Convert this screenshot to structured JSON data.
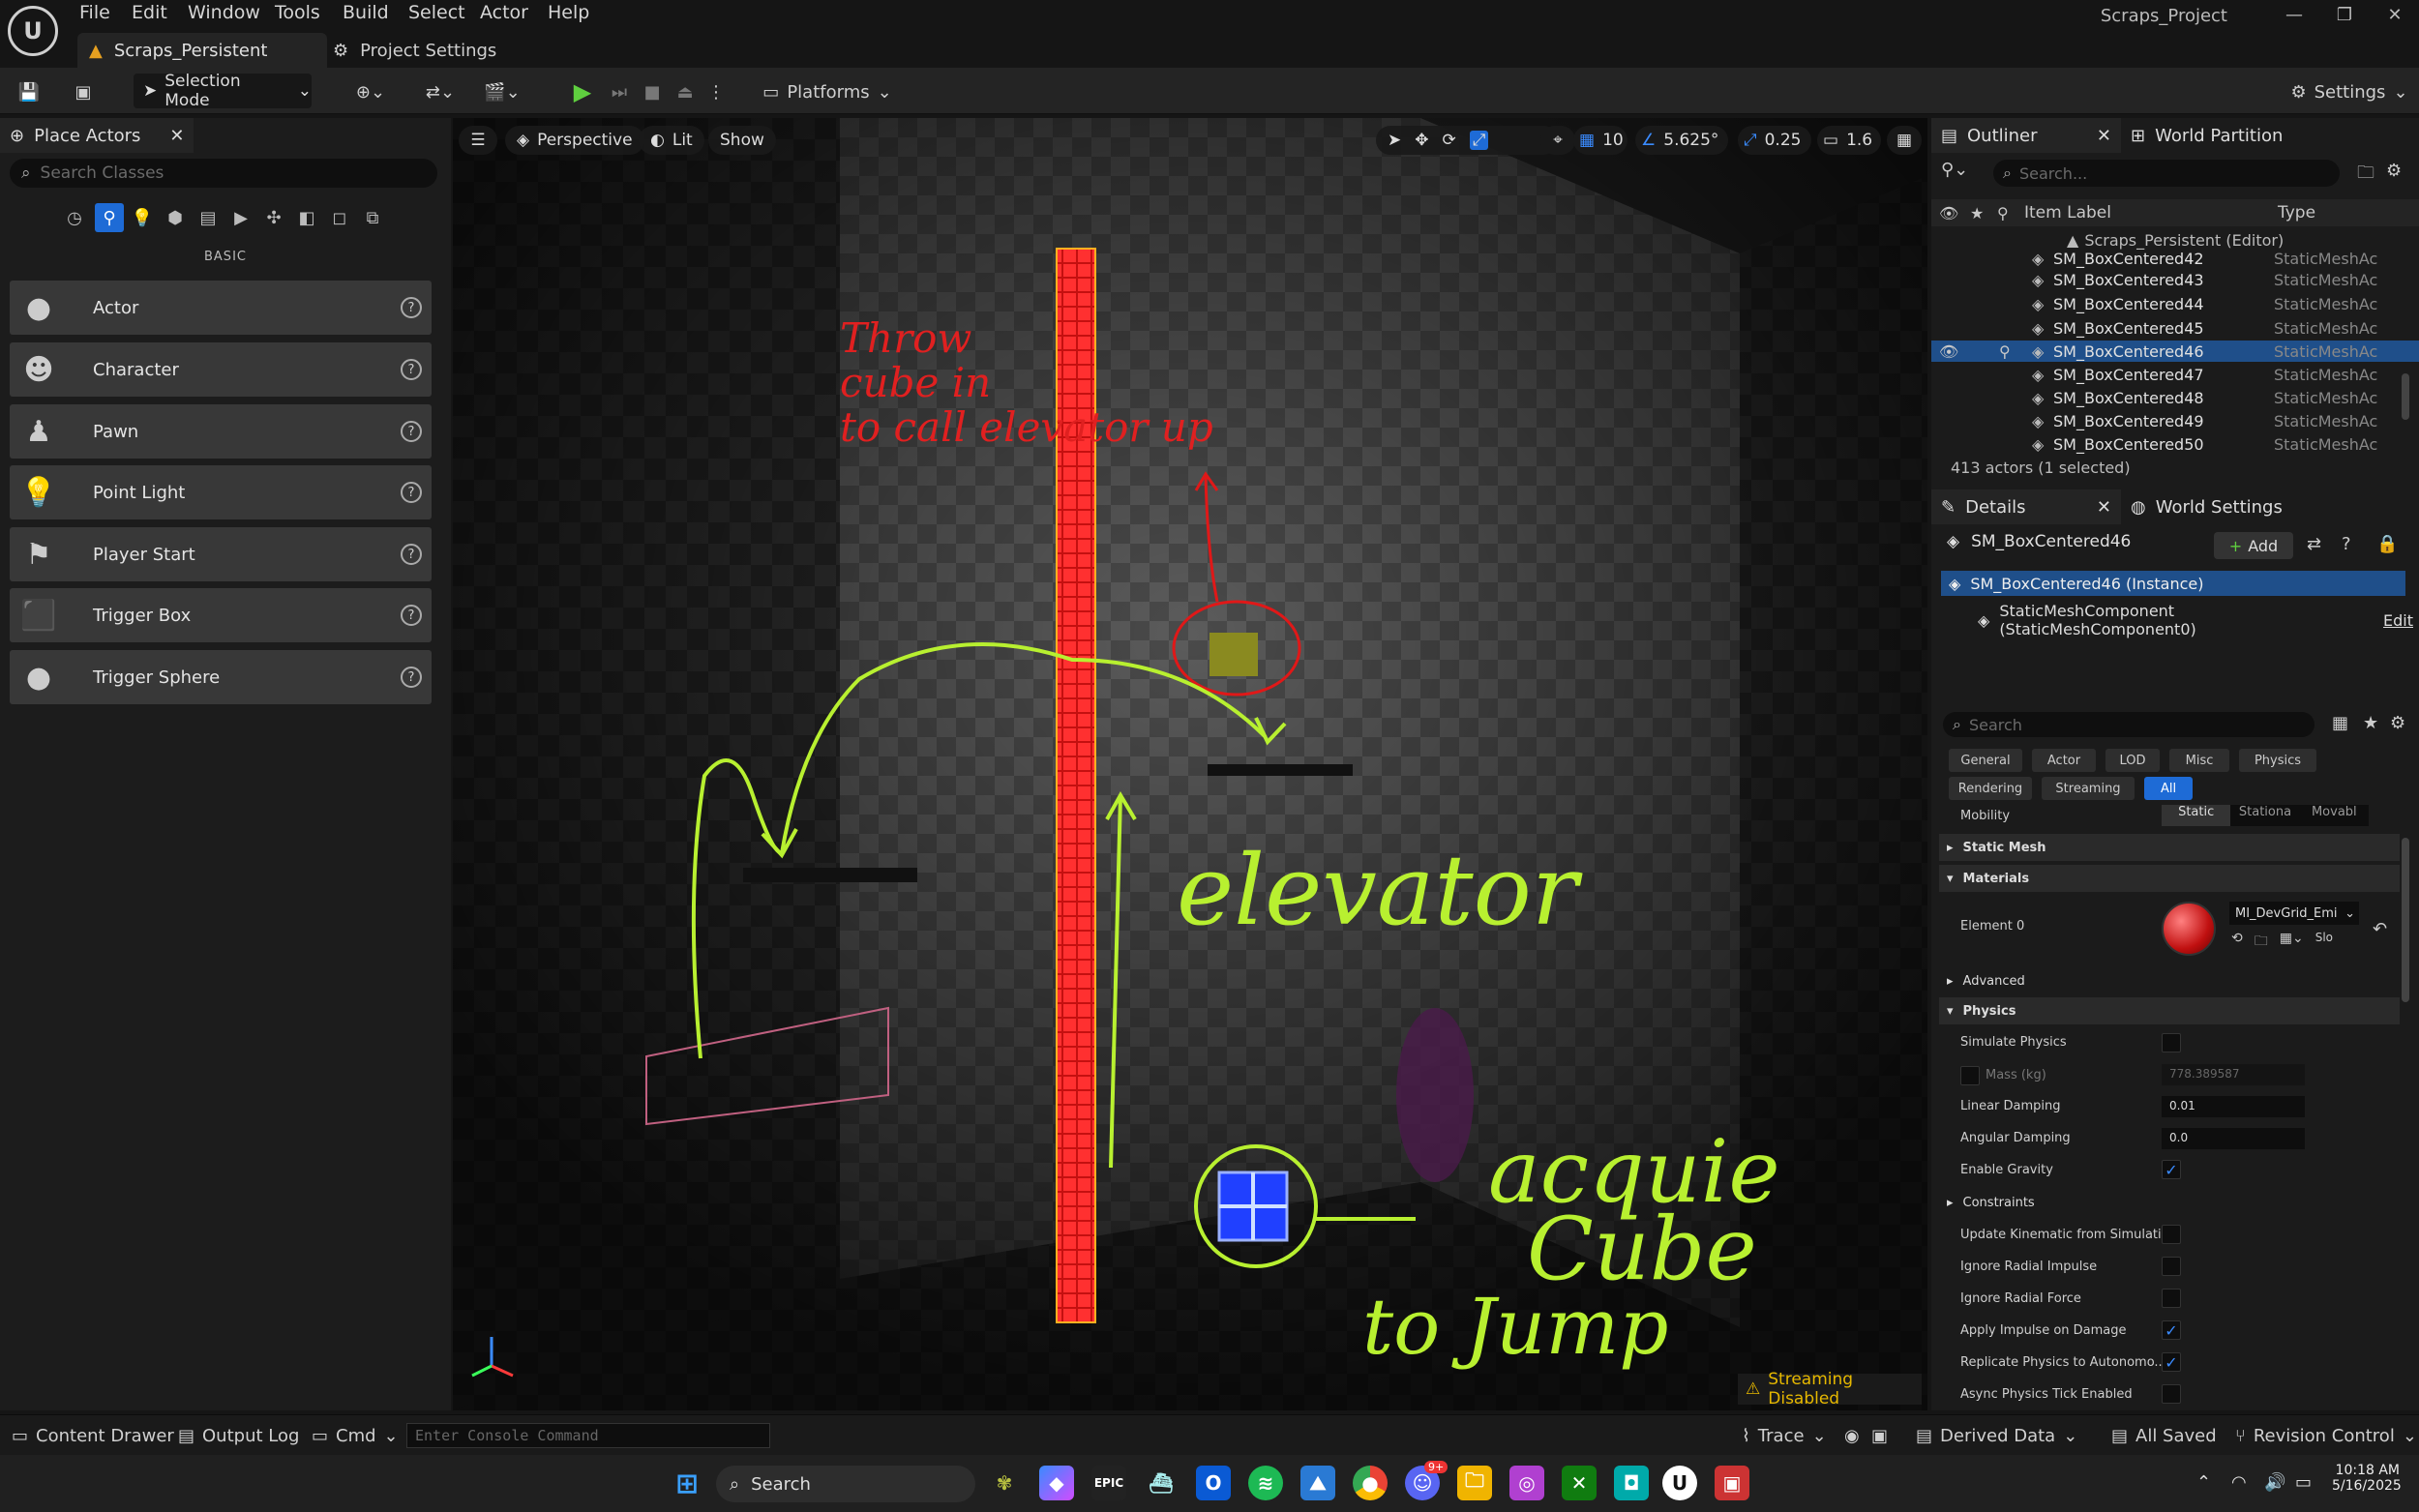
{
  "titlebar": {
    "menus": [
      "File",
      "Edit",
      "Window",
      "Tools",
      "Build",
      "Select",
      "Actor",
      "Help"
    ],
    "doc_tab": "Scraps_Persistent",
    "settings_tab": "Project Settings",
    "project_name": "Scraps_Project"
  },
  "toolbar": {
    "selection_mode": "Selection Mode",
    "platforms": "Platforms",
    "settings": "Settings"
  },
  "place_actors": {
    "tab": "Place Actors",
    "search_placeholder": "Search Classes",
    "section": "BASIC",
    "items": [
      {
        "label": "Actor",
        "icon": "sphere-icon"
      },
      {
        "label": "Character",
        "icon": "character-icon"
      },
      {
        "label": "Pawn",
        "icon": "pawn-icon"
      },
      {
        "label": "Point Light",
        "icon": "light-icon"
      },
      {
        "label": "Player Start",
        "icon": "flag-icon"
      },
      {
        "label": "Trigger Box",
        "icon": "box-icon"
      },
      {
        "label": "Trigger Sphere",
        "icon": "sphere-icon"
      }
    ]
  },
  "viewport": {
    "perspective": "Perspective",
    "lit": "Lit",
    "show": "Show",
    "grid_snap": "10",
    "rot_snap": "5.625°",
    "scale_snap": "0.25",
    "cam_speed": "1.6",
    "streaming": "Streaming Disabled",
    "annotations": {
      "throw": [
        "Throw",
        "cube in",
        "to call elevator up"
      ],
      "elevator": "elevator",
      "acquire": [
        "acquie",
        "Cube",
        "to Jump"
      ]
    }
  },
  "outliner": {
    "tab": "Outliner",
    "tab2": "World Partition",
    "search_placeholder": "Search...",
    "col_label": "Item Label",
    "col_type": "Type",
    "root": "Scraps_Persistent (Editor)",
    "rows": [
      {
        "label": "SM_BoxCentered42",
        "type": "StaticMeshAc"
      },
      {
        "label": "SM_BoxCentered43",
        "type": "StaticMeshAc"
      },
      {
        "label": "SM_BoxCentered44",
        "type": "StaticMeshAc"
      },
      {
        "label": "SM_BoxCentered45",
        "type": "StaticMeshAc"
      },
      {
        "label": "SM_BoxCentered46",
        "type": "StaticMeshAc"
      },
      {
        "label": "SM_BoxCentered47",
        "type": "StaticMeshAc"
      },
      {
        "label": "SM_BoxCentered48",
        "type": "StaticMeshAc"
      },
      {
        "label": "SM_BoxCentered49",
        "type": "StaticMeshAc"
      },
      {
        "label": "SM_BoxCentered50",
        "type": "StaticMeshAc"
      }
    ],
    "status": "413 actors (1 selected)"
  },
  "details": {
    "tab": "Details",
    "tab2": "World Settings",
    "actor_name": "SM_BoxCentered46",
    "add": "Add",
    "instance": "SM_BoxCentered46 (Instance)",
    "component": "StaticMeshComponent (StaticMeshComponent0)",
    "edit": "Edit",
    "search_placeholder": "Search",
    "filters": [
      "General",
      "Actor",
      "LOD",
      "Misc",
      "Physics",
      "Rendering",
      "Streaming",
      "All"
    ],
    "mobility_label": "Mobility",
    "mobility_options": [
      "Static",
      "Stationa",
      "Movabl"
    ],
    "sections": {
      "static_mesh": "Static Mesh",
      "materials": "Materials",
      "advanced": "Advanced",
      "physics": "Physics",
      "constraints": "Constraints"
    },
    "element0": "Element 0",
    "material_name": "MI_DevGrid_Emi",
    "material_extra": "Slo",
    "props": {
      "simulate_physics": "Simulate Physics",
      "mass": "Mass (kg)",
      "mass_value": "778.389587",
      "linear_damping": "Linear Damping",
      "linear_damping_value": "0.01",
      "angular_damping": "Angular Damping",
      "angular_damping_value": "0.0",
      "enable_gravity": "Enable Gravity",
      "update_kinematic": "Update Kinematic from Simulati...",
      "ignore_radial_impulse": "Ignore Radial Impulse",
      "ignore_radial_force": "Ignore Radial Force",
      "apply_impulse": "Apply Impulse on Damage",
      "replicate_physics": "Replicate Physics to Autonomo...",
      "async_physics": "Async Physics Tick Enabled"
    }
  },
  "statusbar": {
    "content_drawer": "Content Drawer",
    "output_log": "Output Log",
    "cmd": "Cmd",
    "console_placeholder": "Enter Console Command",
    "trace": "Trace",
    "derived_data": "Derived Data",
    "all_saved": "All Saved",
    "revision_control": "Revision Control"
  },
  "taskbar": {
    "search": "Search",
    "time": "10:18 AM",
    "date": "5/16/2025",
    "badge": "9+"
  }
}
